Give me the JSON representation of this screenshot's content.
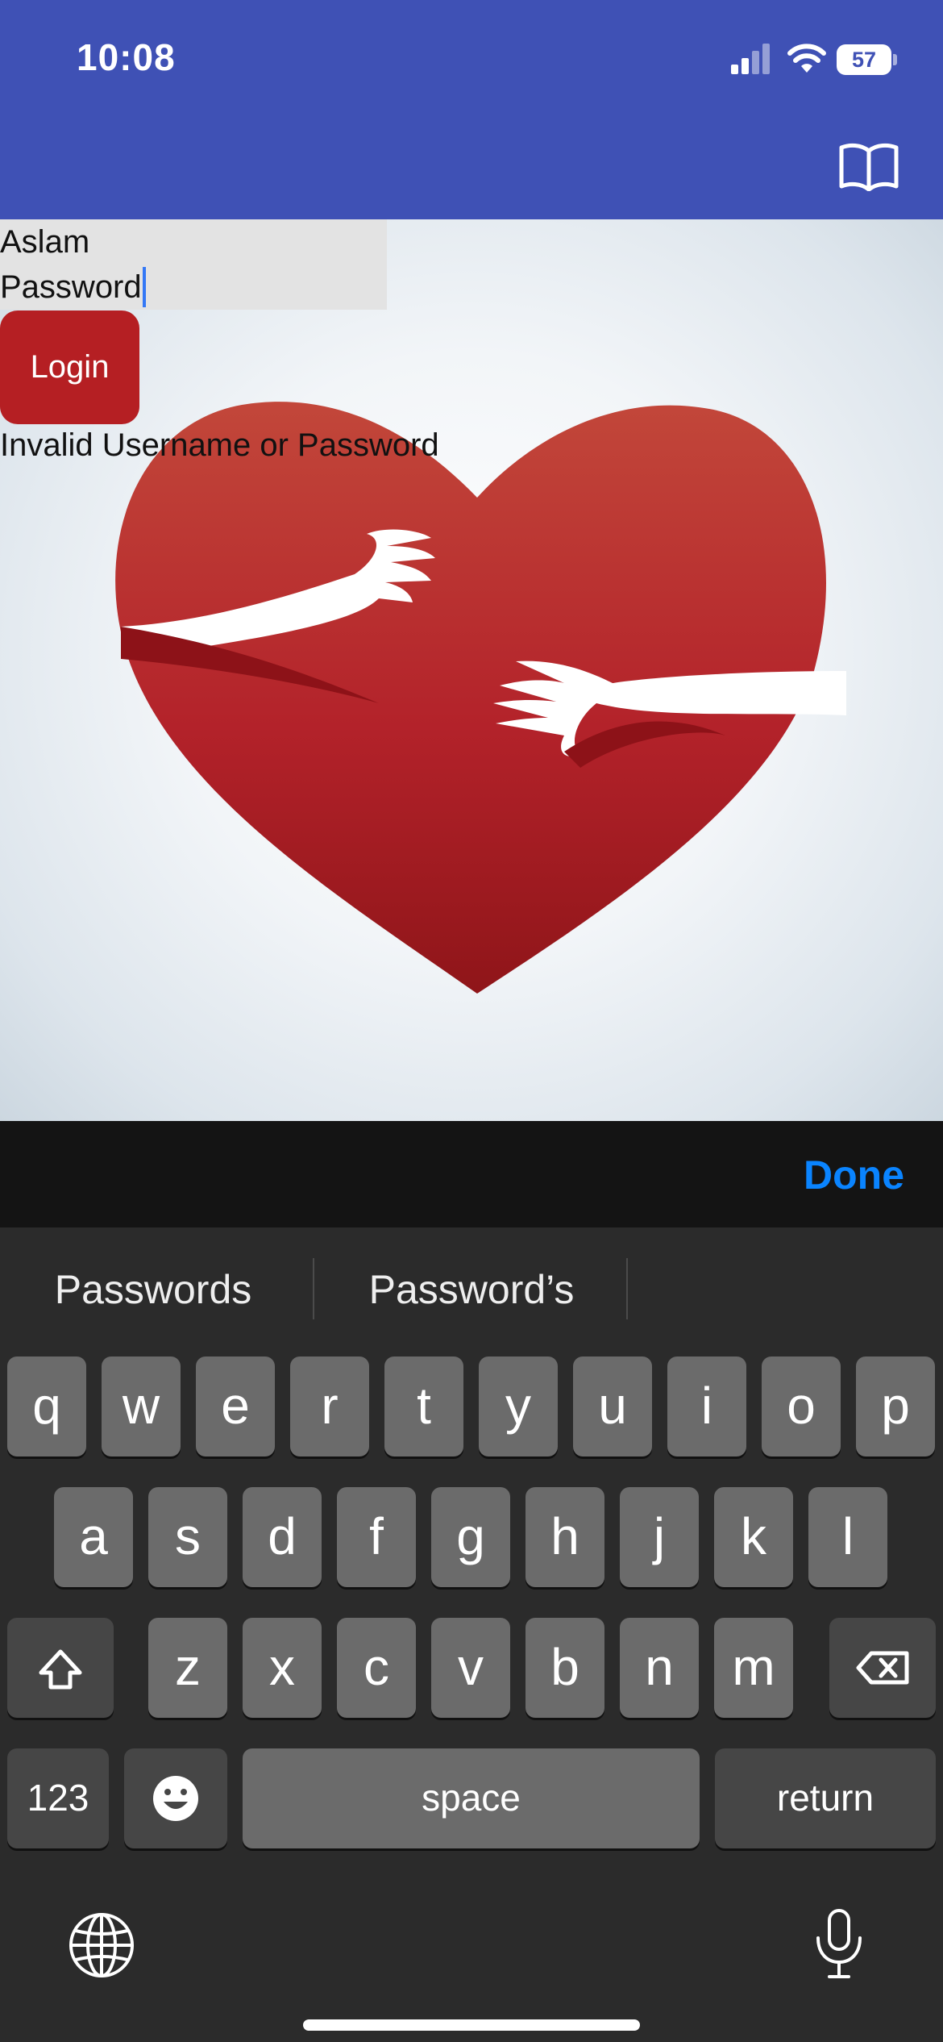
{
  "status_bar": {
    "time": "10:08",
    "battery": "57"
  },
  "header": {
    "icons": [
      "book-icon"
    ]
  },
  "form": {
    "username": "Aslam",
    "password_placeholder": "Password",
    "login_label": "Login",
    "error_message": "Invalid Username or Password"
  },
  "colors": {
    "header": "#3f51b5",
    "button": "#b51f23",
    "heart": "#c0392b",
    "link": "#0a84ff"
  },
  "keyboard": {
    "done_label": "Done",
    "suggestions": [
      "Passwords",
      "Password’s"
    ],
    "row1": [
      "q",
      "w",
      "e",
      "r",
      "t",
      "y",
      "u",
      "i",
      "o",
      "p"
    ],
    "row2": [
      "a",
      "s",
      "d",
      "f",
      "g",
      "h",
      "j",
      "k",
      "l"
    ],
    "row3": [
      "z",
      "x",
      "c",
      "v",
      "b",
      "n",
      "m"
    ],
    "numbers_label": "123",
    "space_label": "space",
    "return_label": "return"
  }
}
